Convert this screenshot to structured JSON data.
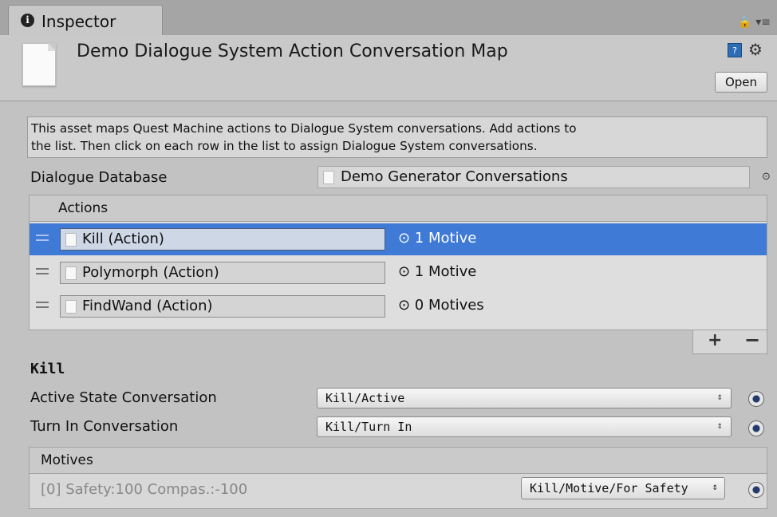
{
  "tab": {
    "icon": "info-icon",
    "icon_glyph": "i",
    "label": "Inspector"
  },
  "header": {
    "title": "Demo Dialogue System Action Conversation Map",
    "open_label": "Open",
    "help_glyph": "?",
    "gear_glyph": "⚙",
    "lock_glyph": "🔒 ▾≡"
  },
  "helpbox": {
    "line1": "This asset maps Quest Machine actions to Dialogue System conversations. Add actions to",
    "line2": "the list. Then click on each row in the list to assign Dialogue System conversations."
  },
  "database": {
    "label": "Dialogue Database",
    "value": "Demo Generator Conversations",
    "target_glyph": "⊙"
  },
  "actions": {
    "header": "Actions",
    "rows": [
      {
        "name": "Kill (Action)",
        "motives": "⊙ 1 Motive",
        "selected": true
      },
      {
        "name": "Polymorph (Action)",
        "motives": "⊙ 1 Motive",
        "selected": false
      },
      {
        "name": "FindWand (Action)",
        "motives": "⊙ 0 Motives",
        "selected": false
      }
    ],
    "plus": "+",
    "minus": "−"
  },
  "selected_action": {
    "title": "Kill",
    "active_label": "Active State Conversation",
    "active_value": "Kill/Active",
    "turnin_label": "Turn In Conversation",
    "turnin_value": "Kill/Turn In",
    "arrow": "⇕"
  },
  "motives": {
    "header": "Motives",
    "item_text": "[0] Safety:100 Compas.:-100",
    "item_value": "Kill/Motive/For Safety",
    "arrow": "⇕"
  },
  "colors": {
    "selection": "#3f7ad6",
    "background": "#c2c2c2"
  }
}
